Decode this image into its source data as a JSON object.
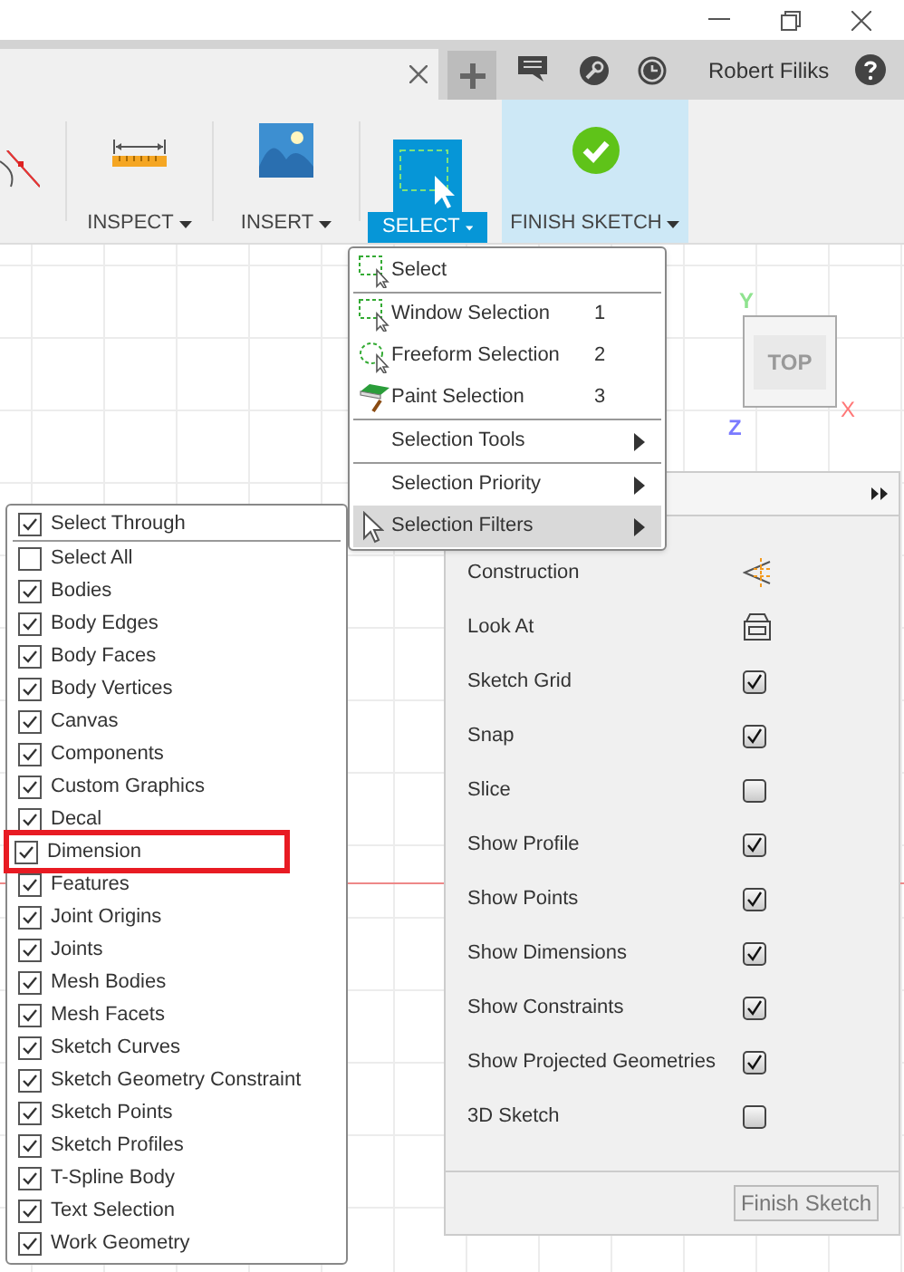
{
  "header": {
    "user_name": "Robert Filiks"
  },
  "toolbar": {
    "groups": [
      {
        "kind": "sketch"
      },
      {
        "kind": "inspect",
        "label": "INSPECT",
        "selected": false
      },
      {
        "kind": "insert",
        "label": "INSERT",
        "selected": false
      },
      {
        "kind": "select",
        "label": "SELECT",
        "selected": true
      },
      {
        "kind": "finish",
        "label": "FINISH SKETCH",
        "selected": false
      }
    ]
  },
  "select_menu": {
    "items": [
      {
        "kind": "select",
        "label": "Select",
        "selected": false,
        "separator_after": true
      },
      {
        "kind": "window",
        "label": "Window Selection",
        "shortcut": "1",
        "selected": false,
        "separator_after": false
      },
      {
        "kind": "freeform",
        "label": "Freeform Selection",
        "shortcut": "2",
        "selected": false,
        "separator_after": false
      },
      {
        "kind": "paint",
        "label": "Paint Selection",
        "shortcut": "3",
        "selected": false,
        "separator_after": true
      },
      {
        "kind": "submenu",
        "label": "Selection Tools",
        "selected": false,
        "separator_after": true
      },
      {
        "kind": "submenu",
        "label": "Selection Priority",
        "selected": false,
        "separator_after": false
      },
      {
        "kind": "submenu",
        "label": "Selection Filters",
        "selected": true,
        "separator_after": false
      }
    ]
  },
  "selection_filters": {
    "items": [
      {
        "label": "Select Through",
        "checked": true,
        "highlighted": false,
        "separator_after": true
      },
      {
        "label": "Select All",
        "checked": false,
        "highlighted": false,
        "separator_after": false
      },
      {
        "label": "Bodies",
        "checked": true,
        "highlighted": false,
        "separator_after": false
      },
      {
        "label": "Body Edges",
        "checked": true,
        "highlighted": false,
        "separator_after": false
      },
      {
        "label": "Body Faces",
        "checked": true,
        "highlighted": false,
        "separator_after": false
      },
      {
        "label": "Body Vertices",
        "checked": true,
        "highlighted": false,
        "separator_after": false
      },
      {
        "label": "Canvas",
        "checked": true,
        "highlighted": false,
        "separator_after": false
      },
      {
        "label": "Components",
        "checked": true,
        "highlighted": false,
        "separator_after": false
      },
      {
        "label": "Custom Graphics",
        "checked": true,
        "highlighted": false,
        "separator_after": false
      },
      {
        "label": "Decal",
        "checked": true,
        "highlighted": false,
        "separator_after": false
      },
      {
        "label": "Dimension",
        "checked": true,
        "highlighted": true,
        "separator_after": false
      },
      {
        "label": "Features",
        "checked": true,
        "highlighted": false,
        "separator_after": false
      },
      {
        "label": "Joint Origins",
        "checked": true,
        "highlighted": false,
        "separator_after": false
      },
      {
        "label": "Joints",
        "checked": true,
        "highlighted": false,
        "separator_after": false
      },
      {
        "label": "Mesh Bodies",
        "checked": true,
        "highlighted": false,
        "separator_after": false
      },
      {
        "label": "Mesh Facets",
        "checked": true,
        "highlighted": false,
        "separator_after": false
      },
      {
        "label": "Sketch Curves",
        "checked": true,
        "highlighted": false,
        "separator_after": false
      },
      {
        "label": "Sketch Geometry Constraint",
        "checked": true,
        "highlighted": false,
        "separator_after": false
      },
      {
        "label": "Sketch Points",
        "checked": true,
        "highlighted": false,
        "separator_after": false
      },
      {
        "label": "Sketch Profiles",
        "checked": true,
        "highlighted": false,
        "separator_after": false
      },
      {
        "label": "T-Spline Body",
        "checked": true,
        "highlighted": false,
        "separator_after": false
      },
      {
        "label": "Text Selection",
        "checked": true,
        "highlighted": false,
        "separator_after": false
      },
      {
        "label": "Work Geometry",
        "checked": true,
        "highlighted": false,
        "separator_after": false
      }
    ]
  },
  "sketch_palette": {
    "rows": [
      {
        "kind": "construction",
        "label": "Construction"
      },
      {
        "kind": "look_at",
        "label": "Look At"
      },
      {
        "kind": "checkbox",
        "label": "Sketch Grid",
        "checked": true
      },
      {
        "kind": "checkbox",
        "label": "Snap",
        "checked": true
      },
      {
        "kind": "checkbox",
        "label": "Slice",
        "checked": false
      },
      {
        "kind": "checkbox",
        "label": "Show Profile",
        "checked": true
      },
      {
        "kind": "checkbox",
        "label": "Show Points",
        "checked": true
      },
      {
        "kind": "checkbox",
        "label": "Show Dimensions",
        "checked": true
      },
      {
        "kind": "checkbox",
        "label": "Show Constraints",
        "checked": true
      },
      {
        "kind": "checkbox",
        "label": "Show Projected Geometries",
        "checked": true
      },
      {
        "kind": "checkbox",
        "label": "3D Sketch",
        "checked": false
      }
    ],
    "finish_button": "Finish Sketch"
  },
  "view_cube": {
    "face": "TOP",
    "axes": {
      "x": "X",
      "y": "Y",
      "z": "Z"
    }
  }
}
